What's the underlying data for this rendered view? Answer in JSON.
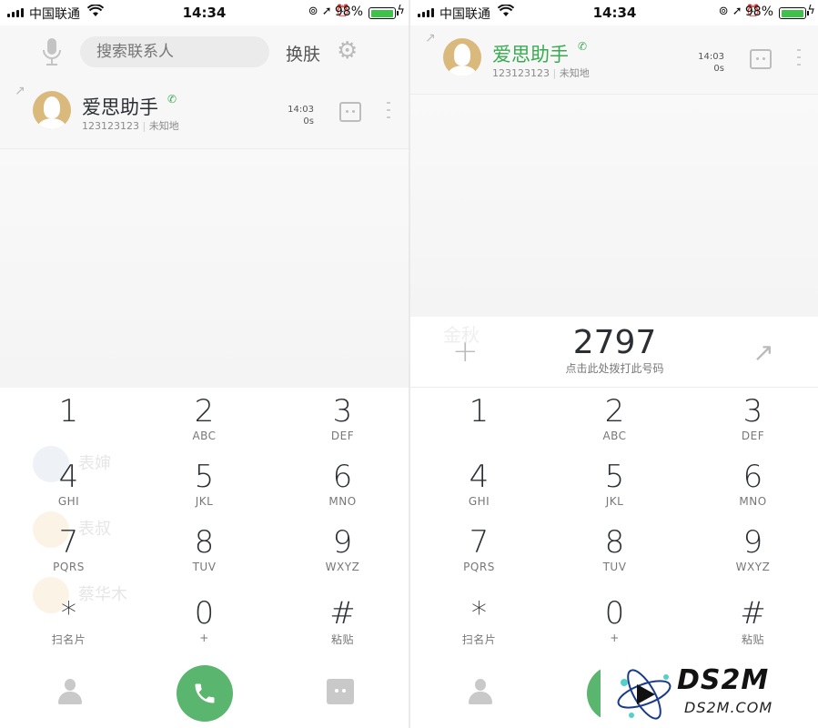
{
  "status": {
    "carrier": "中国联通",
    "time": "14:34",
    "battery_pct": "98%",
    "battery_level": 0.98
  },
  "left": {
    "search_placeholder": "搜索联系人",
    "skin_label": "换肤",
    "call": {
      "name": "爱思助手",
      "number": "123123123",
      "location": "未知地",
      "separator": "|",
      "time": "14:03",
      "duration": "0s"
    }
  },
  "right": {
    "call": {
      "name": "爱思助手",
      "number": "123123123",
      "location": "未知地",
      "separator": "|",
      "time": "14:03",
      "duration": "0s"
    },
    "dialed_number": "2797",
    "dial_hint": "点击此处拨打此号码",
    "plus_label": "+"
  },
  "keypad": [
    {
      "digit": "1",
      "letters": ""
    },
    {
      "digit": "2",
      "letters": "ABC"
    },
    {
      "digit": "3",
      "letters": "DEF"
    },
    {
      "digit": "4",
      "letters": "GHI"
    },
    {
      "digit": "5",
      "letters": "JKL"
    },
    {
      "digit": "6",
      "letters": "MNO"
    },
    {
      "digit": "7",
      "letters": "PQRS"
    },
    {
      "digit": "8",
      "letters": "TUV"
    },
    {
      "digit": "9",
      "letters": "WXYZ"
    },
    {
      "digit": "*",
      "letters": "扫名片"
    },
    {
      "digit": "0",
      "letters": "+"
    },
    {
      "digit": "#",
      "letters": "粘贴"
    }
  ],
  "ghost_contacts": {
    "c1": "表婶",
    "c2": "表叔",
    "c3": "蔡华木",
    "c4": "金秋"
  },
  "watermark": {
    "title": "DS2M",
    "subtitle": "DS2M.COM"
  },
  "colors": {
    "accent_green": "#5ab66f",
    "battery_green": "#3ec24a",
    "avatar_gold": "#d9b97c"
  }
}
